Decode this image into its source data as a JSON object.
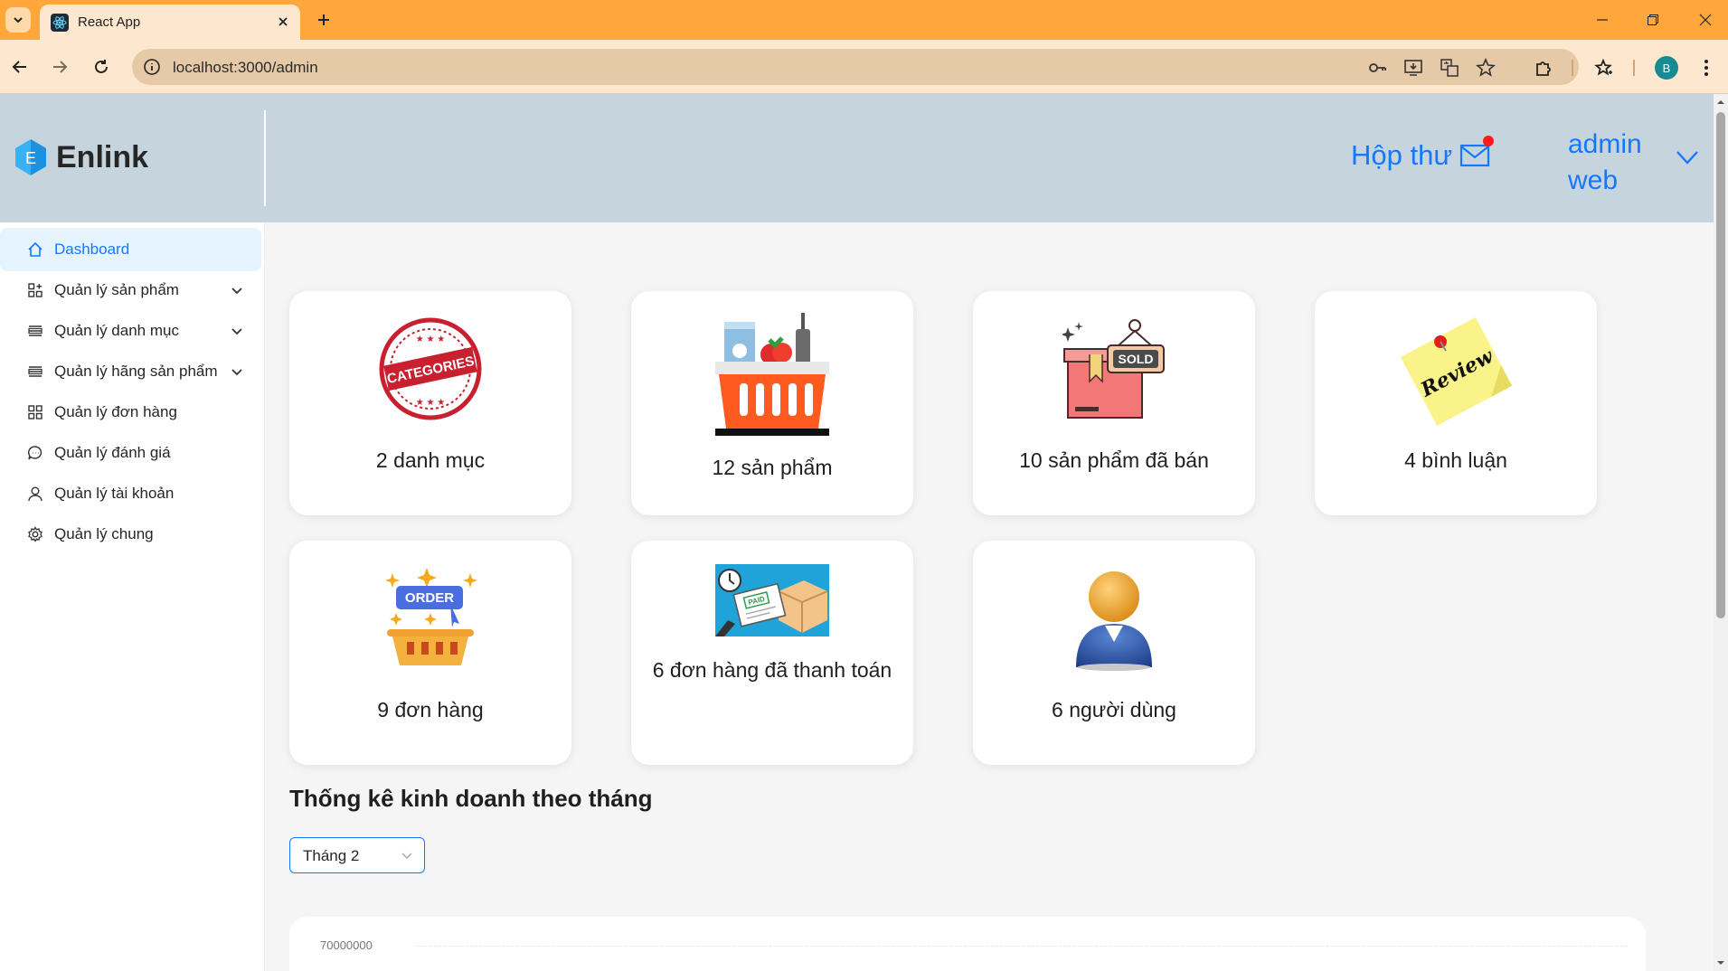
{
  "browser": {
    "tab_title": "React App",
    "url": "localhost:3000/admin",
    "profile_initial": "B"
  },
  "header": {
    "brand": "Enlink",
    "brand_initial": "E",
    "inbox_label": "Hộp thư",
    "user_name": "admin web"
  },
  "sidebar": {
    "items": [
      {
        "label": "Dashboard",
        "icon": "home-icon",
        "active": true
      },
      {
        "label": "Quản lý sản phẩm",
        "icon": "appstore-add-icon",
        "submenu": true
      },
      {
        "label": "Quản lý danh mục",
        "icon": "list-icon",
        "submenu": true
      },
      {
        "label": "Quản lý hãng sản phẩm",
        "icon": "list-icon",
        "submenu": true
      },
      {
        "label": "Quản lý đơn hàng",
        "icon": "appstore-icon"
      },
      {
        "label": "Quản lý đánh giá",
        "icon": "comment-icon"
      },
      {
        "label": "Quản lý tài khoản",
        "icon": "user-icon"
      },
      {
        "label": "Quản lý chung",
        "icon": "setting-icon"
      }
    ]
  },
  "stats": [
    {
      "label": "2 danh mục",
      "icon": "categories-stamp-icon",
      "stamp_text": "CATEGORIES"
    },
    {
      "label": "12 sản phẩm",
      "icon": "shopping-basket-icon"
    },
    {
      "label": "10 sản phẩm đã bán",
      "icon": "sold-box-icon",
      "sign_text": "SOLD"
    },
    {
      "label": "4 bình luận",
      "icon": "review-note-icon",
      "note_text": "Review"
    },
    {
      "label": "9 đơn hàng",
      "icon": "order-basket-icon",
      "sign_text": "ORDER"
    },
    {
      "label": "6 đơn hàng đã thanh toán",
      "icon": "paid-order-icon",
      "stamp_text": "PAID"
    },
    {
      "label": "6 người dùng",
      "icon": "user-avatar-icon"
    }
  ],
  "section": {
    "title": "Thống kê kinh doanh theo tháng",
    "month_selected": "Tháng 2"
  },
  "chart_data": {
    "type": "bar",
    "title": "",
    "y_tick_visible": "70000000"
  },
  "colors": {
    "accent": "#1677ff",
    "tabbar": "#ffa73b",
    "header_bg": "#c6d5dd"
  }
}
